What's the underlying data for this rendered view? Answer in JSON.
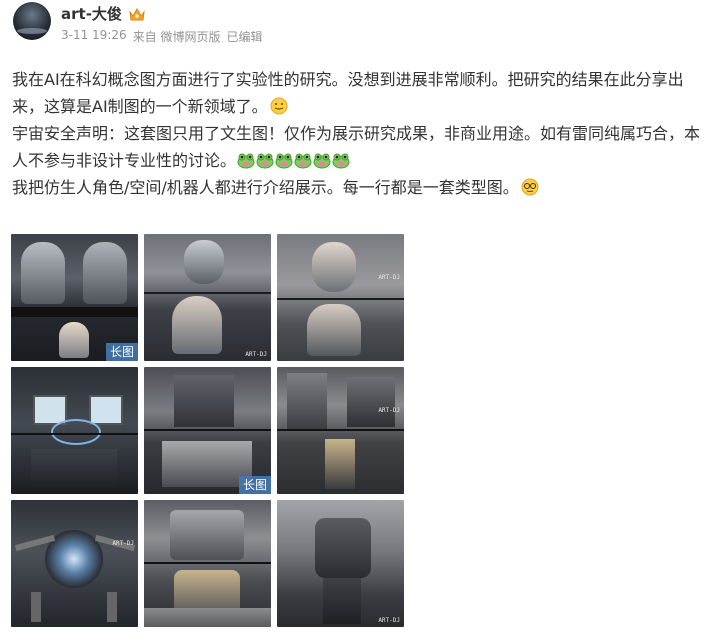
{
  "post": {
    "username": "art-大俊",
    "date": "3-11 19:26",
    "source": "来自 微博网页版",
    "edited": "已编辑",
    "paragraphs": [
      "我在AI在科幻概念图方面进行了实验性的研究。没想到进展非常顺利。把研究的结果在此分享出来，这算是AI制图的一个新领域了。",
      "宇宙安全声明：这套图只用了文生图！仅作为展示研究成果，非商业用途。如有雷同纯属巧合，本人不参与非设计专业性的讨论。",
      "我把仿生人角色/空间/机器人都进行介绍展示。每一行都是一套类型图。"
    ],
    "paragraph_emoji": [
      "smile-emoji",
      "frog-emoji x6",
      "nerd-emoji"
    ]
  },
  "images": {
    "long_image_badge": "长图",
    "watermark": "ART-DJ",
    "tiles": [
      {
        "subject": "android-figures",
        "has_badge": true
      },
      {
        "subject": "android-workshop",
        "has_badge": false
      },
      {
        "subject": "android-portrait",
        "has_badge": false
      },
      {
        "subject": "monitor-lab",
        "has_badge": false
      },
      {
        "subject": "machine-space",
        "has_badge": true
      },
      {
        "subject": "industrial-corridor",
        "has_badge": false
      },
      {
        "subject": "robot-mech",
        "has_badge": false
      },
      {
        "subject": "hangar-mech",
        "has_badge": false
      },
      {
        "subject": "mech-closeup",
        "has_badge": false
      }
    ]
  },
  "colors": {
    "username": "#333333",
    "meta": "#939393",
    "badge_bg": "#4678af",
    "crown": "#f5a623"
  }
}
